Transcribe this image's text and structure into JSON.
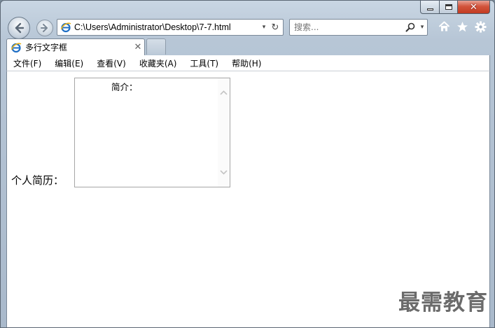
{
  "window": {
    "caption": {
      "minimize": "–",
      "maximize": "□",
      "close": "✕"
    }
  },
  "nav": {
    "back_icon": "back-arrow-icon",
    "forward_icon": "forward-arrow-icon",
    "address": "C:\\Users\\Administrator\\Desktop\\7-7.html",
    "address_dropdown": "▾",
    "refresh": "↻",
    "search_placeholder": "搜索...",
    "search_dropdown": "▾"
  },
  "tab": {
    "title": "多行文字框",
    "close": "✕"
  },
  "menu": {
    "items": [
      "文件(F)",
      "编辑(E)",
      "查看(V)",
      "收藏夹(A)",
      "工具(T)",
      "帮助(H)"
    ]
  },
  "content": {
    "label": "个人简历：",
    "textarea_value": "简介："
  },
  "watermark": "最需教育",
  "colors": {
    "accent_close": "#c23b22",
    "ie_blue": "#1f6fc5",
    "watermark": "#6b6b6b"
  }
}
